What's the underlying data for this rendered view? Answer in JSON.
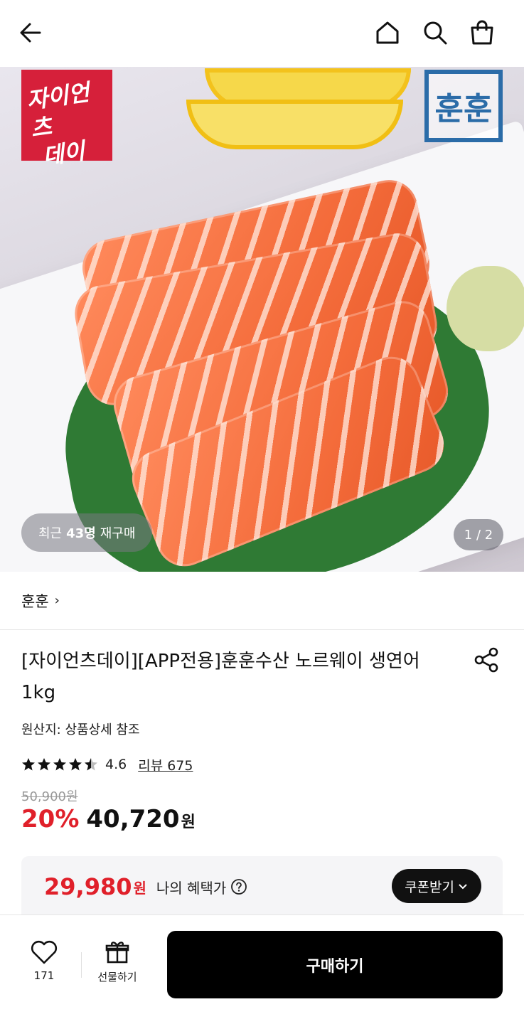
{
  "header": {
    "icons": [
      "back-arrow-icon",
      "home-icon",
      "search-icon",
      "shopping-bag-icon"
    ]
  },
  "hero": {
    "brand_badge_line1": "자이언츠",
    "brand_badge_line2": "데이",
    "seller_logo_text": "훈훈",
    "rebuy_prefix": "최근",
    "rebuy_count": "43명",
    "rebuy_suffix": "재구매",
    "page_indicator": "1 / 2"
  },
  "store": {
    "name": "훈훈",
    "chevron": "›"
  },
  "product": {
    "title": "[자이언츠데이][APP전용]훈훈수산 노르웨이 생연어 1kg",
    "origin": "원산지: 상품상세 참조",
    "rating": "4.6",
    "rating_stars": 4.6,
    "reviews_label": "리뷰 675",
    "original_price": "50,900원",
    "discount": "20%",
    "price": "40,720",
    "price_unit": "원"
  },
  "benefit": {
    "price": "29,980",
    "price_unit": "원",
    "label": "나의 혜택가",
    "coupon_button": "쿠폰받기"
  },
  "bottom_bar": {
    "like_count": "171",
    "gift_label": "선물하기",
    "buy_label": "구매하기"
  },
  "colors": {
    "accent_red": "#e0202a",
    "brand_badge": "#d6203a",
    "seller_logo": "#2b6ca8",
    "button_black": "#000000"
  }
}
